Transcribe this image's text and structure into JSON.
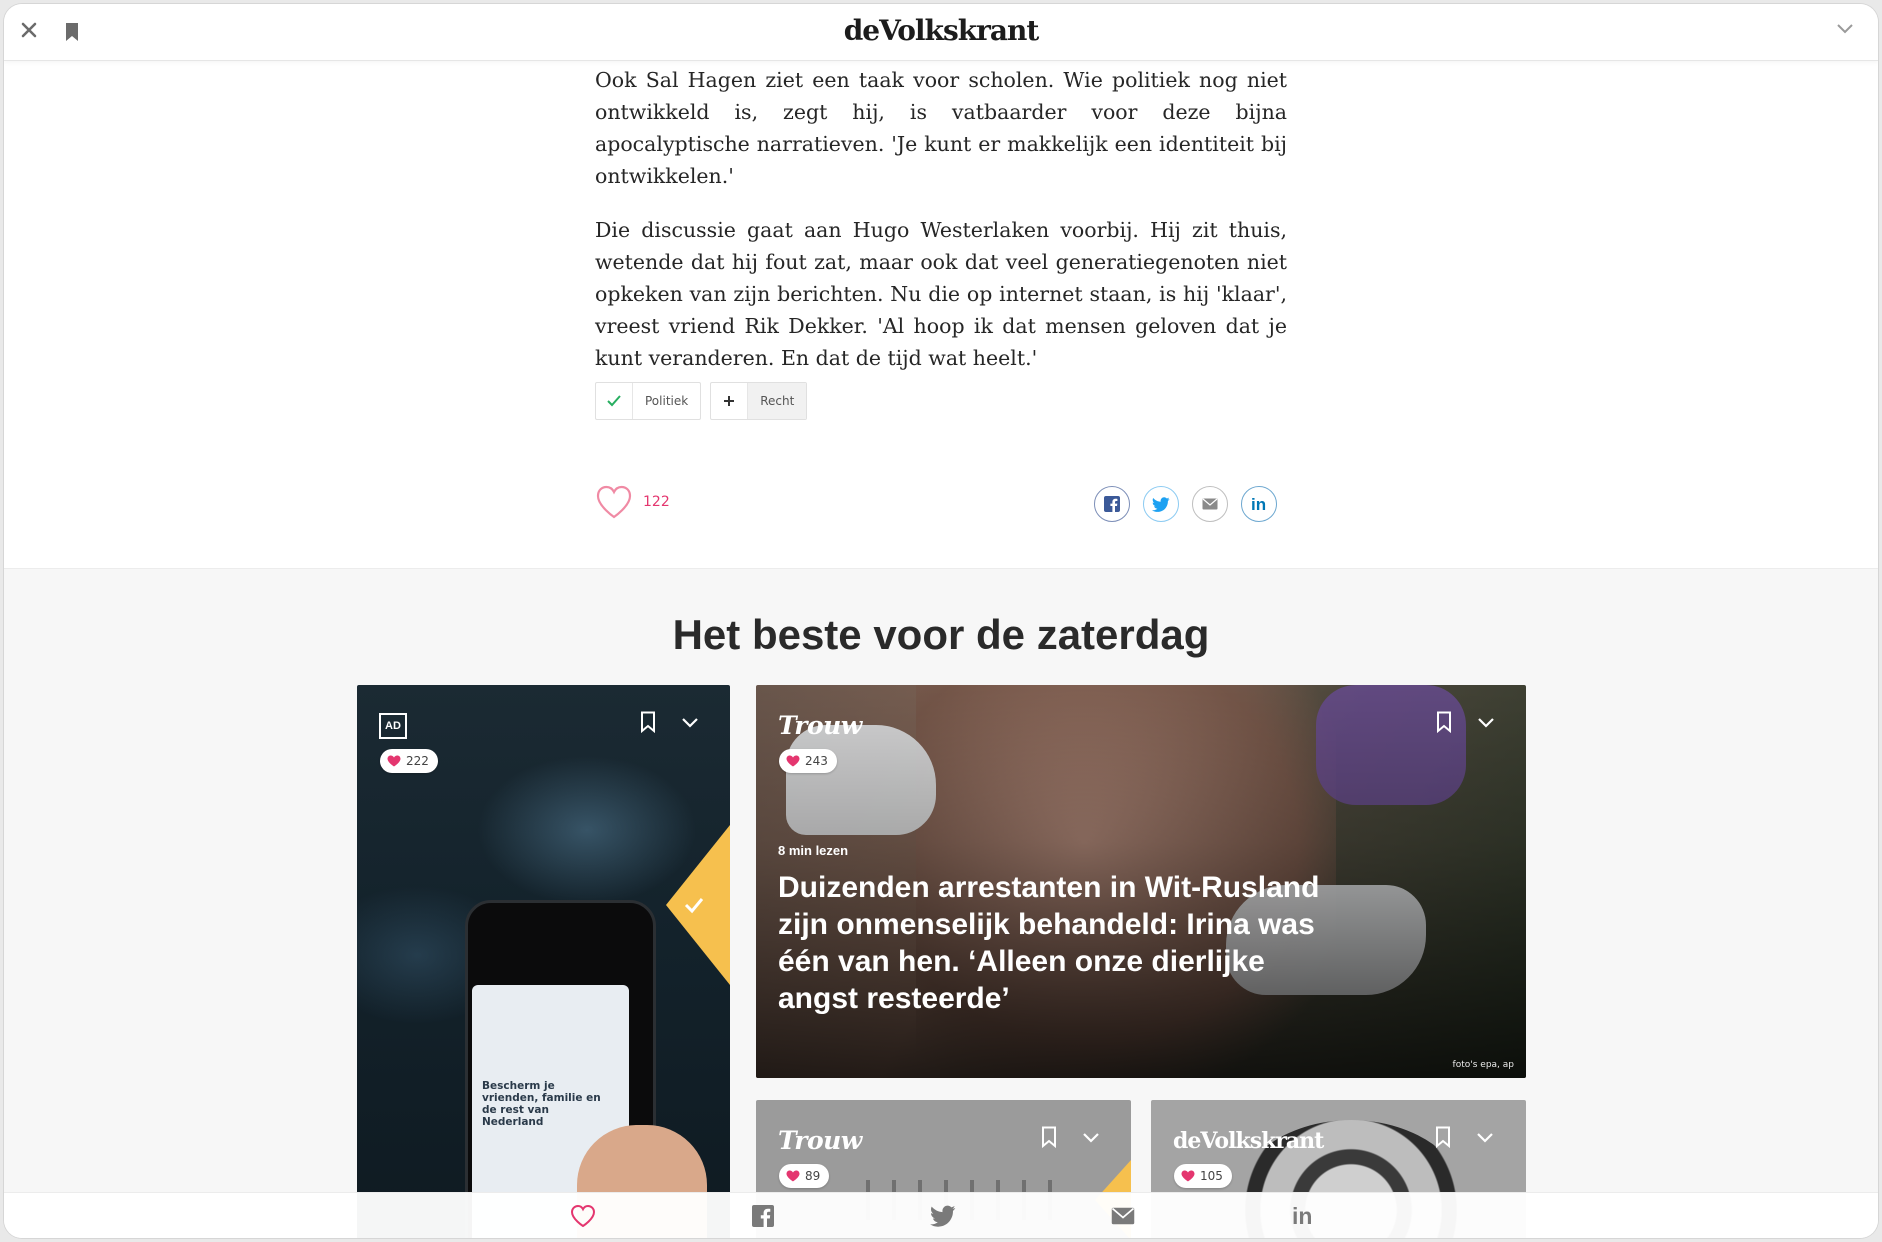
{
  "topbar": {
    "logo": "deVolkskrant",
    "icons": [
      "close-icon",
      "bookmark-icon",
      "chevron-down-icon"
    ]
  },
  "article": {
    "paragraphs": [
      "Ook Sal Hagen ziet een taak voor scholen. Wie politiek nog niet ontwikkeld is, zegt hij, is vatbaarder voor deze bijna apocalyptische narratieven. 'Je kunt er makkelijk een identiteit bij ontwikkelen.'",
      "Die discussie gaat aan Hugo Westerlaken voorbij. Hij zit thuis, wetende dat hij fout zat, maar ook dat veel generatiegenoten niet opkeken van zijn berichten. Nu die op internet staan, is hij 'klaar', vreest vriend Rik Dekker. 'Al hoop ik dat mensen geloven dat je kunt veranderen. En dat de tijd wat heelt.'"
    ],
    "tags": [
      {
        "label": "Politiek",
        "state": "followed",
        "icon": "check-icon"
      },
      {
        "label": "Recht",
        "state": "not-followed",
        "icon": "plus-icon"
      }
    ],
    "likes": "122",
    "share": [
      "facebook-icon",
      "twitter-icon",
      "mail-icon",
      "linkedin-icon"
    ]
  },
  "recommendations": {
    "title": "Het beste voor de zaterdag",
    "cards": [
      {
        "source": "AD",
        "likes": "222",
        "followed": true
      },
      {
        "source": "Trouw",
        "likes": "243",
        "read_time": "8 min lezen",
        "headline": "Duizenden arrestanten in Wit-Rusland zijn onmenselijk behandeld: Irina was één van hen. ‘Alleen onze dierlijke angst resteerde’",
        "credit": "foto's epa, ap"
      },
      {
        "source": "Trouw",
        "likes": "89",
        "followed": true
      },
      {
        "source": "deVolkskrant",
        "likes": "105"
      }
    ],
    "phone_text": "Bescherm je vrienden, familie en de rest van Nederland"
  },
  "bottombar": {
    "icons": [
      "heart-icon",
      "facebook-icon",
      "twitter-icon",
      "mail-icon",
      "linkedin-icon"
    ]
  },
  "colors": {
    "like": "#e4366f",
    "heart_outline": "#f08aa4",
    "followed_triangle": "#f6c04e",
    "check_green": "#27ae60",
    "facebook": "#3b5998",
    "twitter": "#1da1f2",
    "linkedin": "#0077b5"
  }
}
